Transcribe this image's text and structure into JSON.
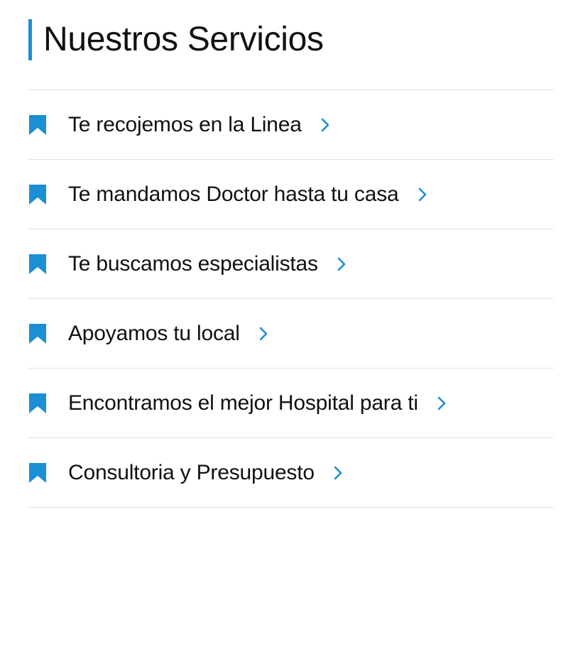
{
  "colors": {
    "accent": "#1a8fd4",
    "text": "#111111",
    "divider": "#e2e2e2",
    "background": "#ffffff"
  },
  "header": {
    "title": "Nuestros Servicios"
  },
  "services": [
    {
      "label": "Te recojemos en la Linea",
      "icon": "bookmark-icon",
      "arrow": "chevron-right-icon"
    },
    {
      "label": "Te mandamos Doctor hasta tu casa",
      "icon": "bookmark-icon",
      "arrow": "chevron-right-icon"
    },
    {
      "label": "Te buscamos especialistas",
      "icon": "bookmark-icon",
      "arrow": "chevron-right-icon"
    },
    {
      "label": "Apoyamos tu local",
      "icon": "bookmark-icon",
      "arrow": "chevron-right-icon"
    },
    {
      "label": "Encontramos el mejor Hospital para ti",
      "icon": "bookmark-icon",
      "arrow": "chevron-right-icon"
    },
    {
      "label": "Consultoria y Presupuesto",
      "icon": "bookmark-icon",
      "arrow": "chevron-right-icon"
    }
  ]
}
